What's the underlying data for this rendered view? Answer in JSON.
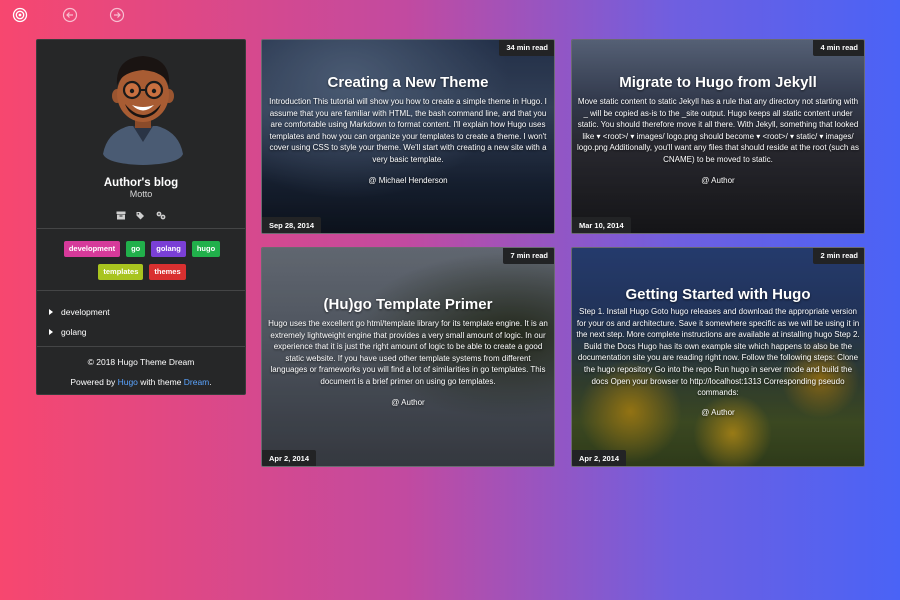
{
  "nav": {
    "icons": [
      "target-icon",
      "arrow-left-circle-icon",
      "arrow-right-circle-icon"
    ]
  },
  "sidebar": {
    "title": "Author's blog",
    "motto": "Motto",
    "icons": [
      "archive-icon",
      "tags-icon",
      "categories-icon"
    ],
    "tags": [
      {
        "label": "development",
        "color": "#d63a9a"
      },
      {
        "label": "go",
        "color": "#21b04b"
      },
      {
        "label": "golang",
        "color": "#7a3fd6"
      },
      {
        "label": "hugo",
        "color": "#21b04b"
      },
      {
        "label": "templates",
        "color": "#a8c41f"
      },
      {
        "label": "themes",
        "color": "#d93030"
      }
    ],
    "categories": [
      "development",
      "golang"
    ],
    "copyright": "© 2018 Hugo Theme Dream",
    "powered_prefix": "Powered by ",
    "powered_hugo": "Hugo",
    "powered_mid": " with theme ",
    "powered_theme": "Dream",
    "powered_suffix": ".",
    "link_color": "#5aa4ff"
  },
  "posts": [
    {
      "title": "Creating a New Theme",
      "read_time": "34 min read",
      "date": "Sep 28, 2014",
      "summary": "Introduction This tutorial will show you how to create a simple theme in Hugo. I assume that you are familiar with HTML, the bash command line, and that you are comfortable using Markdown to format content. I'll explain how Hugo uses templates and how you can organize your templates to create a theme. I won't cover using CSS to style your theme. We'll start with creating a new site with a very basic template.",
      "author": "@ Michael Henderson"
    },
    {
      "title": "Migrate to Hugo from Jekyll",
      "read_time": "4 min read",
      "date": "Mar 10, 2014",
      "summary": "Move static content to static Jekyll has a rule that any directory not starting with _ will be copied as-is to the _site output. Hugo keeps all static content under static. You should therefore move it all there. With Jekyll, something that looked like ▾ <root>/ ▾ images/ logo.png should become ▾ <root>/ ▾ static/ ▾ images/ logo.png Additionally, you'll want any files that should reside at the root (such as CNAME) to be moved to static.",
      "author": "@ Author"
    },
    {
      "title": "(Hu)go Template Primer",
      "read_time": "7 min read",
      "date": "Apr 2, 2014",
      "summary": "Hugo uses the excellent go html/template library for its template engine. It is an extremely lightweight engine that provides a very small amount of logic. In our experience that it is just the right amount of logic to be able to create a good static website. If you have used other template systems from different languages or frameworks you will find a lot of similarities in go templates. This document is a brief primer on using go templates.",
      "author": "@ Author"
    },
    {
      "title": "Getting Started with Hugo",
      "read_time": "2 min read",
      "date": "Apr 2, 2014",
      "summary": "Step 1. Install Hugo Goto hugo releases and download the appropriate version for your os and architecture. Save it somewhere specific as we will be using it in the next step. More complete instructions are available at installing hugo Step 2. Build the Docs Hugo has its own example site which happens to also be the documentation site you are reading right now. Follow the following steps: Clone the hugo repository Go into the repo Run hugo in server mode and build the docs Open your browser to http://localhost:1313 Corresponding pseudo commands:",
      "author": "@ Author"
    }
  ]
}
